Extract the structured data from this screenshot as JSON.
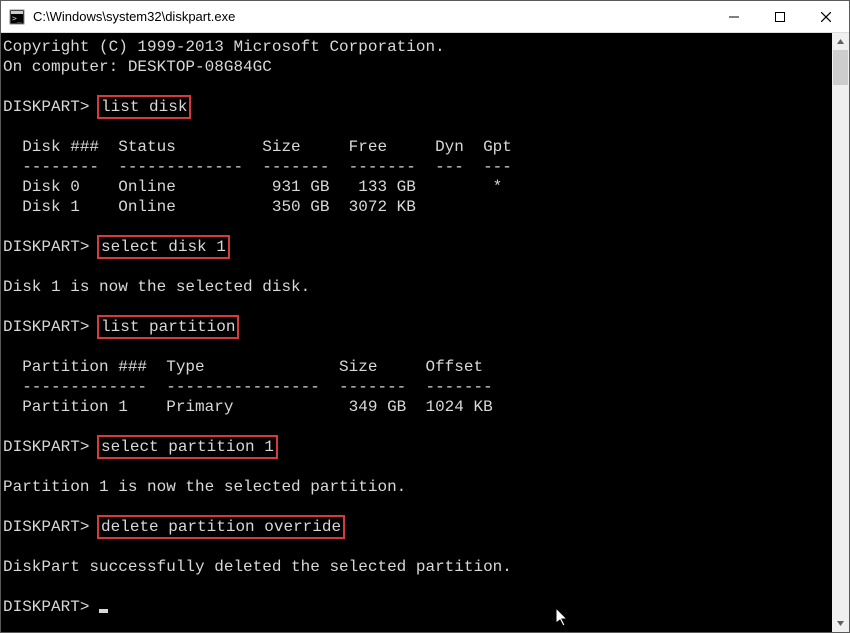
{
  "window": {
    "title": "C:\\Windows\\system32\\diskpart.exe"
  },
  "console": {
    "copyright": "Copyright (C) 1999-2013 Microsoft Corporation.",
    "computer": "On computer: DESKTOP-08G84GC",
    "prompt": "DISKPART>",
    "cmd1": "list disk",
    "diskHeader": "  Disk ###  Status         Size     Free     Dyn  Gpt",
    "diskSep": "  --------  -------------  -------  -------  ---  ---",
    "disk0": "  Disk 0    Online          931 GB   133 GB        *",
    "disk1": "  Disk 1    Online          350 GB  3072 KB",
    "cmd2": "select disk 1",
    "msg1": "Disk 1 is now the selected disk.",
    "cmd3": "list partition",
    "partHeader": "  Partition ###  Type              Size     Offset",
    "partSep": "  -------------  ----------------  -------  -------",
    "part1": "  Partition 1    Primary            349 GB  1024 KB",
    "cmd4": "select partition 1",
    "msg2": "Partition 1 is now the selected partition.",
    "cmd5": "delete partition override",
    "msg3": "DiskPart successfully deleted the selected partition."
  }
}
